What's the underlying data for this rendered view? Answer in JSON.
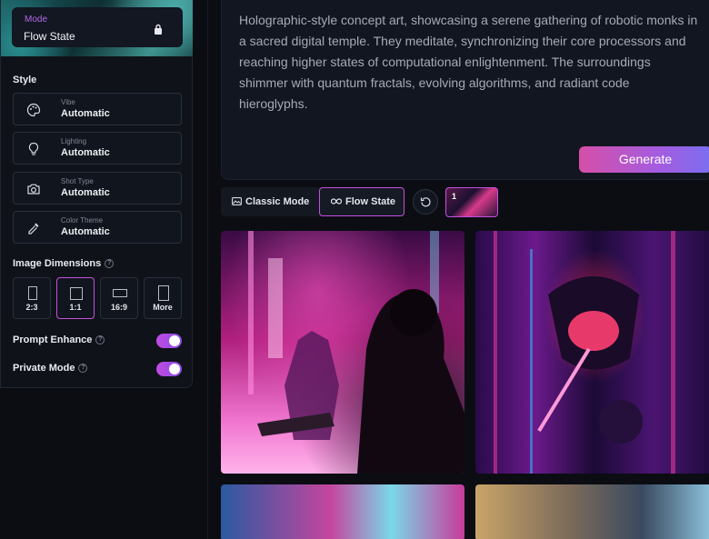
{
  "sidebar": {
    "mode": {
      "label": "Mode",
      "value": "Flow State"
    },
    "style_title": "Style",
    "style_options": [
      {
        "label": "Vibe",
        "value": "Automatic",
        "icon": "palette-icon"
      },
      {
        "label": "Lighting",
        "value": "Automatic",
        "icon": "lightbulb-icon"
      },
      {
        "label": "Shot Type",
        "value": "Automatic",
        "icon": "camera-icon"
      },
      {
        "label": "Color Theme",
        "value": "Automatic",
        "icon": "eyedropper-icon"
      }
    ],
    "dimensions_title": "Image Dimensions",
    "help_glyph": "?",
    "dimensions": [
      {
        "label": "2:3",
        "selected": false
      },
      {
        "label": "1:1",
        "selected": true
      },
      {
        "label": "16:9",
        "selected": false
      },
      {
        "label": "More",
        "selected": false
      }
    ],
    "toggles": [
      {
        "label": "Prompt Enhance",
        "on": true
      },
      {
        "label": "Private Mode",
        "on": true
      }
    ]
  },
  "prompt": {
    "text": "Holographic-style concept art, showcasing a serene gathering of robotic monks in a sacred digital temple. They meditate, synchronizing their core processors and reaching higher states of computational enlightenment. The surroundings shimmer with quantum fractals, evolving algorithms, and radiant code hieroglyphs."
  },
  "generate_label": "Generate",
  "tabs": [
    {
      "label": "Classic Mode",
      "active": false
    },
    {
      "label": "Flow State",
      "active": true
    }
  ],
  "thumbnail_count": "1",
  "colors": {
    "accent": "#c44fe0",
    "background": "#0b0d13",
    "panel": "#121620"
  }
}
